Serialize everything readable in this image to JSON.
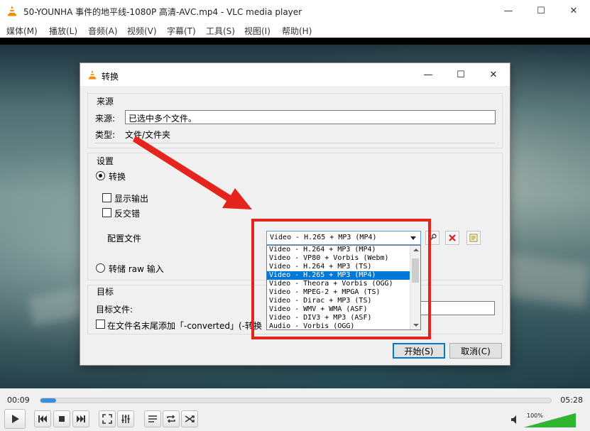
{
  "window": {
    "title": "50-YOUNHA 事件的地平线-1080P 高清-AVC.mp4 - VLC media player",
    "minimize": "—",
    "maximize": "☐",
    "close": "✕"
  },
  "menu": [
    "媒体(M)",
    "播放(L)",
    "音频(A)",
    "视频(V)",
    "字幕(T)",
    "工具(S)",
    "视图(I)",
    "帮助(H)"
  ],
  "dialog": {
    "title": "转换",
    "source": {
      "group_title": "来源",
      "source_label": "来源:",
      "source_value": "已选中多个文件。",
      "type_label": "类型:",
      "type_value": "文件/文件夹"
    },
    "settings": {
      "group_title": "设置",
      "convert_radio": "转换",
      "show_output": "显示输出",
      "deinterlace": "反交错",
      "profile_label": "配置文件",
      "profile_selected": "Video - H.265 + MP3 (MP4)",
      "dump_raw": "转储 raw 输入"
    },
    "profile_options": [
      "Video - H.264 + MP3 (MP4)",
      "Video - VP80 + Vorbis (Webm)",
      "Video - H.264 + MP3 (TS)",
      "Video - H.265 + MP3 (MP4)",
      "Video - Theora + Vorbis (OGG)",
      "Video - MPEG-2 + MPGA (TS)",
      "Video - Dirac + MP3 (TS)",
      "Video - WMV + WMA (ASF)",
      "Video - DIV3 + MP3 (ASF)",
      "Audio - Vorbis (OGG)"
    ],
    "selected_option_index": 3,
    "destination": {
      "group_title": "目标",
      "file_label": "目标文件:",
      "append_suffix": "在文件名末尾添加「-converted」(-转换"
    },
    "start_button": "开始(S)",
    "cancel_button": "取消(C)"
  },
  "player": {
    "time_elapsed": "00:09",
    "time_total": "05:28",
    "progress_fraction": 0.03,
    "volume": "100%",
    "volume_fraction": 1.0
  },
  "colors": {
    "accent": "#0078d7",
    "highlight": "#e5241d",
    "vlc_orange": "#f48b00",
    "volume_green": "#2fb52f"
  }
}
